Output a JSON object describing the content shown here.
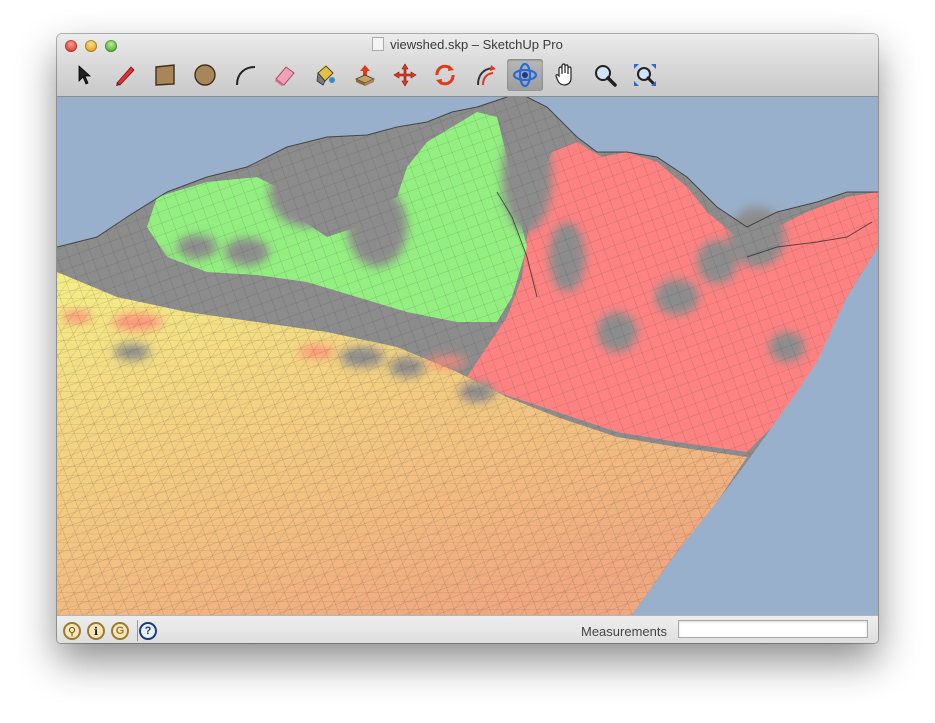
{
  "window": {
    "title": "viewshed.skp – SketchUp Pro"
  },
  "toolbar": {
    "tools": [
      {
        "name": "select",
        "icon": "select-arrow-icon"
      },
      {
        "name": "line",
        "icon": "pencil-icon"
      },
      {
        "name": "rectangle",
        "icon": "rectangle-icon"
      },
      {
        "name": "circle",
        "icon": "circle-icon"
      },
      {
        "name": "arc",
        "icon": "arc-icon"
      },
      {
        "name": "eraser",
        "icon": "eraser-icon"
      },
      {
        "name": "paint-bucket",
        "icon": "paint-bucket-icon"
      },
      {
        "name": "push-pull",
        "icon": "push-pull-icon"
      },
      {
        "name": "move",
        "icon": "move-icon"
      },
      {
        "name": "rotate",
        "icon": "rotate-icon"
      },
      {
        "name": "offset",
        "icon": "offset-icon"
      },
      {
        "name": "orbit",
        "icon": "orbit-icon",
        "active": true
      },
      {
        "name": "pan",
        "icon": "pan-hand-icon"
      },
      {
        "name": "zoom",
        "icon": "zoom-magnifier-icon"
      },
      {
        "name": "zoom-extents",
        "icon": "zoom-extents-icon"
      }
    ]
  },
  "viewport": {
    "sky_color": "#99b0cc",
    "legend_colors": {
      "visible_far": "#8ff17f",
      "visible_near": "#f2ef86",
      "hidden": "#ff8080",
      "unanalyzed": "#808080",
      "ground_near": "#f3b57f"
    }
  },
  "statusbar": {
    "icons": [
      "geo-location-icon",
      "credits-icon",
      "google-sign-in-icon",
      "help-icon"
    ],
    "measurements_label": "Measurements",
    "measurements_value": ""
  }
}
